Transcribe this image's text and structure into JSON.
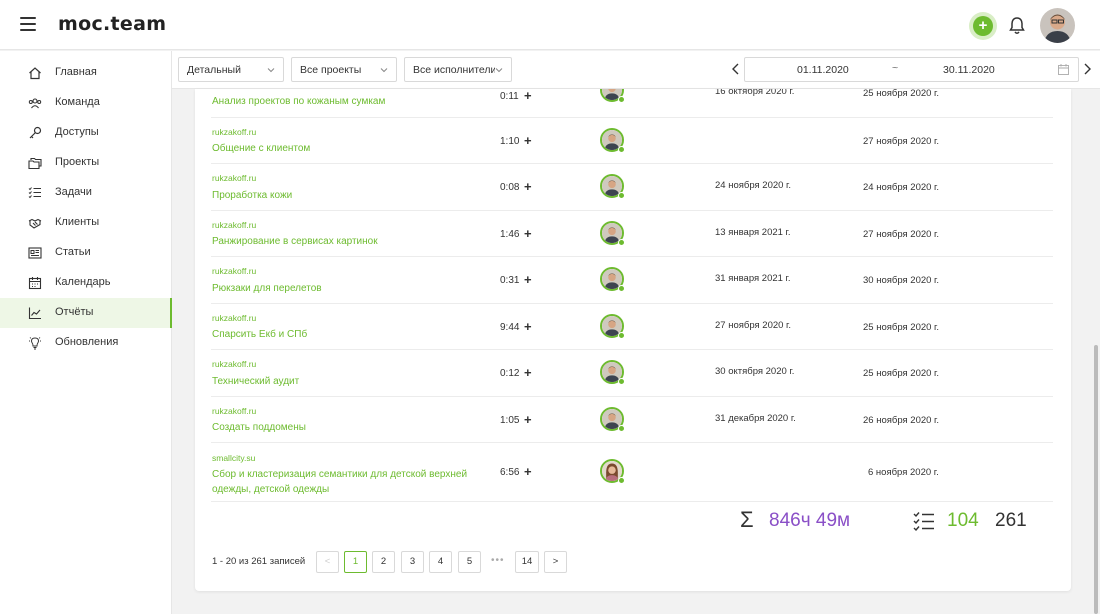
{
  "header": {
    "logo": "moc.team",
    "colors": {
      "accent": "#6dbb2f",
      "total_time": "#8a4fc7"
    }
  },
  "sidebar": {
    "items": [
      {
        "label": "Главная",
        "icon": "home-icon"
      },
      {
        "label": "Команда",
        "icon": "team-icon"
      },
      {
        "label": "Доступы",
        "icon": "key-icon"
      },
      {
        "label": "Проекты",
        "icon": "folders-icon"
      },
      {
        "label": "Задачи",
        "icon": "tasks-icon"
      },
      {
        "label": "Клиенты",
        "icon": "handshake-icon"
      },
      {
        "label": "Статьи",
        "icon": "articles-icon"
      },
      {
        "label": "Календарь",
        "icon": "calendar-icon"
      },
      {
        "label": "Отчёты",
        "icon": "chart-icon",
        "active": true
      },
      {
        "label": "Обновления",
        "icon": "bulb-icon"
      }
    ]
  },
  "filters": {
    "mode": "Детальный",
    "projects": "Все проекты",
    "assignees": "Все исполнители",
    "date_from": "01.11.2020",
    "date_sep": "~",
    "date_to": "30.11.2020"
  },
  "rows": [
    {
      "site": "",
      "task": "Анализ проектов по кожаным сумкам",
      "time": "0:11",
      "start": "16 октября 2020 г.",
      "end": "25 ноября 2020 г."
    },
    {
      "site": "rukzakoff.ru",
      "task": "Общение с клиентом",
      "time": "1:10",
      "start": "",
      "end": "27 ноября 2020 г."
    },
    {
      "site": "rukzakoff.ru",
      "task": "Проработка кожи",
      "time": "0:08",
      "start": "24 ноября 2020 г.",
      "end": "24 ноября 2020 г."
    },
    {
      "site": "rukzakoff.ru",
      "task": "Ранжирование в сервисах картинок",
      "time": "1:46",
      "start": "13 января 2021 г.",
      "end": "27 ноября 2020 г."
    },
    {
      "site": "rukzakoff.ru",
      "task": "Рюкзаки для перелетов",
      "time": "0:31",
      "start": "31 января 2021 г.",
      "end": "30 ноября 2020 г."
    },
    {
      "site": "rukzakoff.ru",
      "task": "Спарсить Екб и СПб",
      "time": "9:44",
      "start": "27 ноября 2020 г.",
      "end": "25 ноября 2020 г."
    },
    {
      "site": "rukzakoff.ru",
      "task": "Технический аудит",
      "time": "0:12",
      "start": "30 октября 2020 г.",
      "end": "25 ноября 2020 г."
    },
    {
      "site": "rukzakoff.ru",
      "task": "Создать поддомены",
      "time": "1:05",
      "start": "31 декабря 2020 г.",
      "end": "26 ноября 2020 г."
    },
    {
      "site": "smallcity.su",
      "task": "Сбор и кластеризация семантики для детской верхней одежды, детской одежды",
      "time": "6:56",
      "start": "",
      "end": "6 ноября 2020 г."
    }
  ],
  "totals": {
    "sigma": "Σ",
    "time": "846ч 49м",
    "done": "104",
    "all": "261"
  },
  "pagination": {
    "info": "1 - 20 из 261 записей",
    "prev": "<",
    "next": ">",
    "pages": [
      "1",
      "2",
      "3",
      "4",
      "5"
    ],
    "dots": "•••",
    "last": "14"
  }
}
